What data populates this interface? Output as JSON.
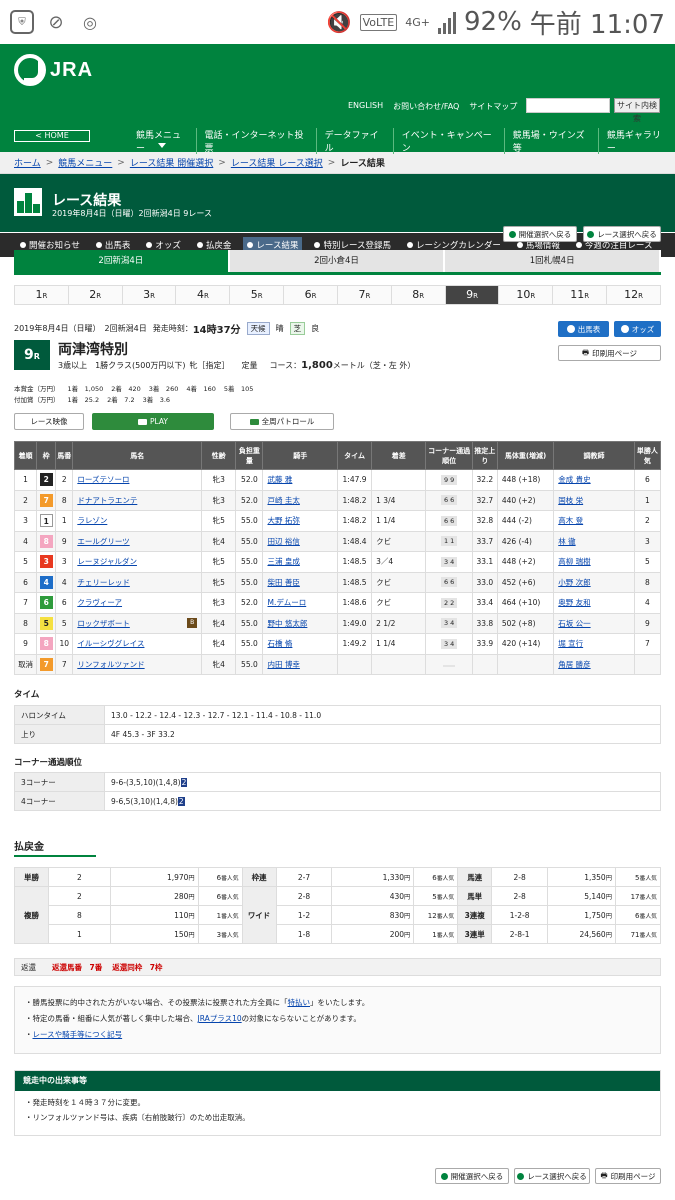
{
  "status": {
    "battery": "92%",
    "time": "午前 11:07",
    "network": "4G+",
    "volte": "VoLTE"
  },
  "header": {
    "logo": "JRA",
    "home": "< HOME",
    "links": [
      "ENGLISH",
      "お問い合わせ/FAQ",
      "サイトマップ"
    ],
    "search_button": "サイト内検索",
    "nav": [
      "競馬メニュー",
      "電話・インターネット投票",
      "データファイル",
      "イベント・キャンペーン",
      "競馬場・ウインズ等",
      "競馬ギャラリー"
    ]
  },
  "breadcrumb": [
    "ホーム",
    "競馬メニュー",
    "レース結果 開催選択",
    "レース結果 レース選択",
    "レース結果"
  ],
  "title": {
    "main": "レース結果",
    "sub": "2019年8月4日（日曜）2回新潟4日 9レース"
  },
  "subnav": [
    "開催お知らせ",
    "出馬表",
    "オッズ",
    "払戻金",
    "レース結果",
    "特別レース登録馬",
    "レーシングカレンダー",
    "馬場情報",
    "今週の注目レース"
  ],
  "utility": {
    "back_meeting": "開催選択へ戻る",
    "back_race": "レース選択へ戻る",
    "print": "印刷用ページ"
  },
  "venues": [
    "2回新潟4日",
    "2回小倉4日",
    "1回札幌4日"
  ],
  "races": [
    "1",
    "2",
    "3",
    "4",
    "5",
    "6",
    "7",
    "8",
    "9",
    "10",
    "11",
    "12"
  ],
  "race_suffix": "R",
  "race": {
    "date": "2019年8月4日（日曜）　2回新潟4日",
    "start_label": "発走時刻：",
    "start_time": "14時37分",
    "weather_label": "天候",
    "weather": "晴",
    "track_label": "芝",
    "track": "良",
    "num": "9",
    "name": "両津湾特別",
    "cond1": "3歳以上　1勝クラス(500万円以下)",
    "cond2": "牝［指定］",
    "cond3": "定量",
    "course_label": "コース：",
    "course": "1,800",
    "course_unit": "メートル（芝・左 外）",
    "btn_card": "出馬表",
    "btn_odds": "オッズ",
    "print": "印刷用ページ",
    "prize_label": "本賞金（万円）",
    "prize": [
      "1着　1,050",
      "2着　420",
      "3着　260",
      "4着　160",
      "5着　105"
    ],
    "addprize_label": "付加賞（万円）",
    "addprize": [
      "1着　25.2",
      "2着　7.2",
      "3着　3.6"
    ]
  },
  "video": {
    "label": "レース映像",
    "play": "PLAY",
    "patrol": "全周パトロール"
  },
  "result_headers": [
    "着順",
    "枠",
    "馬番",
    "馬名",
    "性齢",
    "負担重量",
    "騎手",
    "タイム",
    "着差",
    "コーナー通過順位",
    "推定上り",
    "馬体重(増減)",
    "調教師",
    "単勝人気"
  ],
  "results": [
    {
      "pos": "1",
      "waku": "2",
      "num": "2",
      "horse": "ローズテソーロ",
      "sex": "牝3",
      "wt": "52.0",
      "jockey": "武藤 雅",
      "time": "1:47.9",
      "margin": "",
      "corner": "9 9",
      "last": "32.2",
      "bw": "448 (+18)",
      "trainer": "金成 貴史",
      "pop": "6"
    },
    {
      "pos": "2",
      "waku": "7",
      "num": "8",
      "horse": "ドナアトラエンテ",
      "sex": "牝3",
      "wt": "52.0",
      "jockey": "戸崎 圭太",
      "time": "1:48.2",
      "margin": "1 3/4",
      "corner": "6 6",
      "last": "32.7",
      "bw": "440 (+2)",
      "trainer": "国枝 栄",
      "pop": "1"
    },
    {
      "pos": "3",
      "waku": "1",
      "num": "1",
      "horse": "ラレゾン",
      "sex": "牝5",
      "wt": "55.0",
      "jockey": "大野 拓弥",
      "time": "1:48.2",
      "margin": "1 1/4",
      "corner": "6 6",
      "last": "32.8",
      "bw": "444 (-2)",
      "trainer": "高木 登",
      "pop": "2"
    },
    {
      "pos": "4",
      "waku": "8",
      "num": "9",
      "horse": "エールグリーツ",
      "sex": "牝4",
      "wt": "55.0",
      "jockey": "田辺 裕信",
      "time": "1:48.4",
      "margin": "クビ",
      "corner": "1 1",
      "last": "33.7",
      "bw": "426 (-4)",
      "trainer": "林 徹",
      "pop": "3"
    },
    {
      "pos": "5",
      "waku": "3",
      "num": "3",
      "horse": "レーヌジャルダン",
      "sex": "牝5",
      "wt": "55.0",
      "jockey": "三浦 皇成",
      "time": "1:48.5",
      "margin": "3／4",
      "corner": "3 4",
      "last": "33.1",
      "bw": "448 (+2)",
      "trainer": "高柳 瑞樹",
      "pop": "5"
    },
    {
      "pos": "6",
      "waku": "4",
      "num": "4",
      "horse": "チェリーレッド",
      "sex": "牝5",
      "wt": "55.0",
      "jockey": "柴田 善臣",
      "time": "1:48.5",
      "margin": "クビ",
      "corner": "6 6",
      "last": "33.0",
      "bw": "452 (+6)",
      "trainer": "小野 次郎",
      "pop": "8"
    },
    {
      "pos": "7",
      "waku": "6",
      "num": "6",
      "horse": "クラヴィーア",
      "sex": "牝3",
      "wt": "52.0",
      "jockey": "M.デムーロ",
      "time": "1:48.6",
      "margin": "クビ",
      "corner": "2 2",
      "last": "33.4",
      "bw": "464 (+10)",
      "trainer": "奥野 友和",
      "pop": "4"
    },
    {
      "pos": "8",
      "waku": "5",
      "num": "5",
      "horse": "ロックザボート",
      "blinker": "B",
      "sex": "牝4",
      "wt": "55.0",
      "jockey": "野中 悠太郎",
      "time": "1:49.0",
      "margin": "2 1/2",
      "corner": "3 4",
      "last": "33.8",
      "bw": "502 (+8)",
      "trainer": "石坂 公一",
      "pop": "9"
    },
    {
      "pos": "9",
      "waku": "8",
      "num": "10",
      "horse": "イルーシヴグレイス",
      "sex": "牝4",
      "wt": "55.0",
      "jockey": "石橋 脩",
      "time": "1:49.2",
      "margin": "1 1/4",
      "corner": "3 4",
      "last": "33.9",
      "bw": "420 (+14)",
      "trainer": "堀 宣行",
      "pop": "7"
    },
    {
      "pos": "取消",
      "waku": "7",
      "num": "7",
      "horse": "リンフォルツァンド",
      "sex": "牝4",
      "wt": "55.0",
      "jockey": "内田 博幸",
      "time": "",
      "margin": "",
      "corner": "",
      "last": "",
      "bw": "",
      "trainer": "角居 勝彦",
      "pop": ""
    }
  ],
  "time_section": {
    "title": "タイム",
    "halon_label": "ハロンタイム",
    "halon": "13.0 - 12.2 - 12.4 - 12.3 - 12.7 - 12.1 - 11.4 - 10.8 - 11.0",
    "agari_label": "上り",
    "agari": "4F 45.3 - 3F 33.2"
  },
  "corner_section": {
    "title": "コーナー通過順位",
    "c3_label": "3コーナー",
    "c3": "9-6-(3,5,10)(1,4,8)",
    "c3_end": "2",
    "c4_label": "4コーナー",
    "c4": "9-6,5(3,10)(1,4,8)",
    "c4_end": "2"
  },
  "payout": {
    "title": "払戻金",
    "tansho": {
      "label": "単勝",
      "num": "2",
      "yen": "1,970",
      "pop": "6"
    },
    "fukusho": {
      "label": "複勝",
      "rows": [
        {
          "num": "2",
          "yen": "280",
          "pop": "6"
        },
        {
          "num": "8",
          "yen": "110",
          "pop": "1"
        },
        {
          "num": "1",
          "yen": "150",
          "pop": "3"
        }
      ]
    },
    "wakuren": {
      "label": "枠連",
      "num": "2-7",
      "yen": "1,330",
      "pop": "6"
    },
    "wide": {
      "label": "ワイド",
      "rows": [
        {
          "num": "2-8",
          "yen": "430",
          "pop": "5"
        },
        {
          "num": "1-2",
          "yen": "830",
          "pop": "12"
        },
        {
          "num": "1-8",
          "yen": "200",
          "pop": "1"
        }
      ]
    },
    "umaren": {
      "label": "馬連",
      "num": "2-8",
      "yen": "1,350",
      "pop": "5"
    },
    "umatan": {
      "label": "馬単",
      "num": "2-8",
      "yen": "5,140",
      "pop": "17"
    },
    "sanrenpuku": {
      "label": "3連複",
      "num": "1-2-8",
      "yen": "1,750",
      "pop": "6"
    },
    "sanrentan": {
      "label": "3連単",
      "num": "2-8-1",
      "yen": "24,560",
      "pop": "71"
    },
    "yen_unit": "円",
    "pop_unit": "番人気"
  },
  "refund": {
    "label": "返還",
    "horse": "返還馬番　7番",
    "waku": "返還同枠　7枠"
  },
  "notes": {
    "n1a": "勝馬投票に的中された方がいない場合、その投票法に投票された方全員に「",
    "n1link": "特払い",
    "n1b": "」をいたします。",
    "n2a": "特定の馬番・組番に人気が著しく集中した場合、",
    "n2link": "JRAプラス10",
    "n2b": "の対象にならないことがあります。",
    "n3link": "レースや騎手等につく記号"
  },
  "events": {
    "title": "競走中の出来事等",
    "e1": "発走時刻を１４時３７分に変更。",
    "e2": "リンフォルツァンド号は、疾病〔右前肢跛行〕のため出走取消。"
  },
  "colors": {
    "jra_green": "#00833e",
    "dark_green": "#005a3c",
    "waku": [
      "#ffffff",
      "#222222",
      "#e83820",
      "#1e6ec8",
      "#f5e041",
      "#2e9b3c",
      "#f39a2b",
      "#f4a6c0"
    ]
  }
}
